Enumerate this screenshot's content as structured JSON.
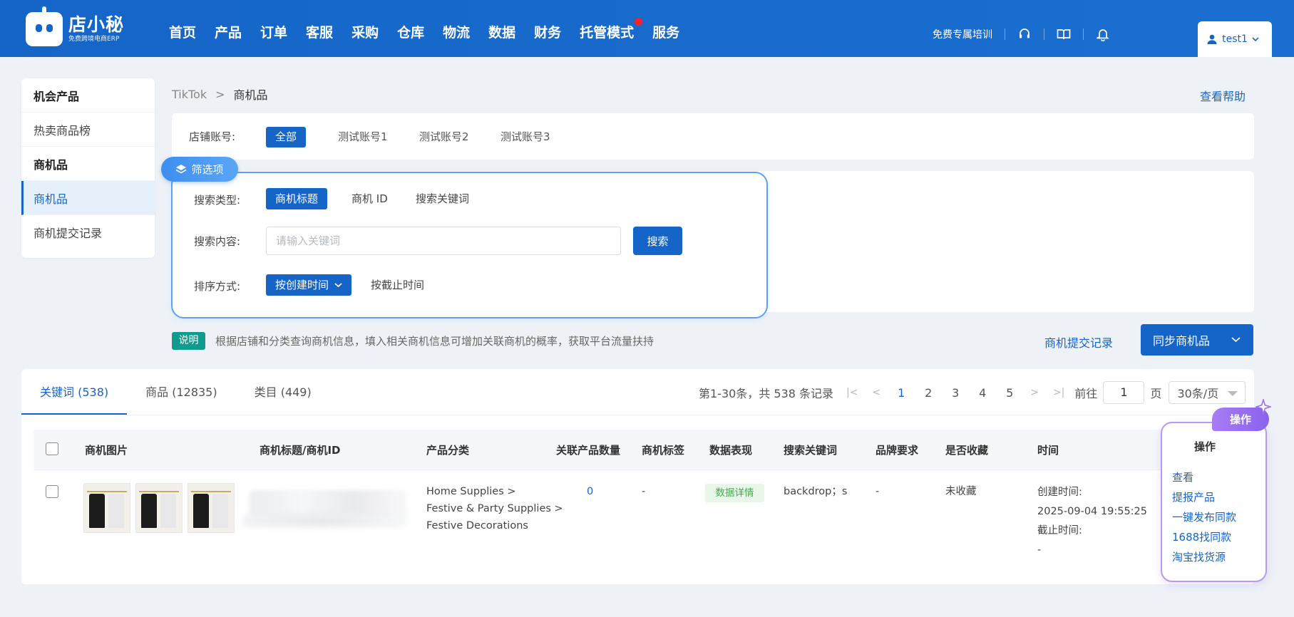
{
  "app": {
    "logo_title": "店小秘",
    "logo_sub": "免费跨境电商ERP"
  },
  "nav": {
    "items": [
      "首页",
      "产品",
      "订单",
      "客服",
      "采购",
      "仓库",
      "物流",
      "数据",
      "财务",
      "托管模式",
      "服务"
    ]
  },
  "topright": {
    "training": "免费专属培训",
    "user": "test1"
  },
  "sidebar": {
    "group1": "机会产品",
    "item_hot": "热卖商品榜",
    "group2": "商机品",
    "item_active": "商机品",
    "item_records": "商机提交记录"
  },
  "breadcrumb": {
    "root": "TikTok",
    "sep": ">",
    "current": "商机品"
  },
  "help": "查看帮助",
  "store": {
    "label": "店铺账号:",
    "options": [
      "全部",
      "测试账号1",
      "测试账号2",
      "测试账号3"
    ],
    "selected": "全部"
  },
  "filter": {
    "tag": "筛选项",
    "search_type_label": "搜索类型:",
    "search_types": [
      "商机标题",
      "商机 ID",
      "搜索关键词"
    ],
    "search_content_label": "搜索内容:",
    "search_placeholder": "请输入关键词",
    "search_button": "搜索",
    "sort_label": "排序方式:",
    "sort_options": [
      "按创建时间",
      "按截止时间"
    ]
  },
  "notice": {
    "badge": "说明",
    "text": "根据店铺和分类查询商机信息，填入相关商机信息可增加关联商机的概率，获取平台流量扶持"
  },
  "actions": {
    "submit_records": "商机提交记录",
    "sync_button": "同步商机品"
  },
  "tabs": [
    "关键词 (538)",
    "商品 (12835)",
    "类目 (449)"
  ],
  "pager": {
    "summary": "第1-30条，共 538 条记录",
    "pages": [
      "1",
      "2",
      "3",
      "4",
      "5"
    ],
    "current": "1",
    "goto_label": "前往",
    "goto_value": "1",
    "page_unit": "页",
    "page_size": "30条/页"
  },
  "table": {
    "headers": [
      "商机图片",
      "商机标题/商机ID",
      "产品分类",
      "关联产品数量",
      "商机标签",
      "数据表现",
      "搜索关键词",
      "品牌要求",
      "是否收藏",
      "时间"
    ],
    "row": {
      "category_lines": [
        "Home Supplies >",
        "Festive & Party Supplies >",
        "Festive Decorations"
      ],
      "related_count": "0",
      "tag": "-",
      "data_badge": "数据详情",
      "keyword": "backdrop；s",
      "brand": "-",
      "favorite": "未收藏",
      "created_label": "创建时间:",
      "created_value": "2025-09-04 19:55:25",
      "deadline_label": "截止时间:",
      "deadline_value": "-"
    }
  },
  "operation": {
    "tag": "操作",
    "title": "操作",
    "links": [
      "查看",
      "提报产品",
      "一键发布同款",
      "1688找同款",
      "淘宝找货源"
    ]
  },
  "colors": {
    "primary": "#1565c8",
    "purple": "#9b72f2",
    "teal": "#0f9b8e",
    "green": "#3fae4a"
  }
}
